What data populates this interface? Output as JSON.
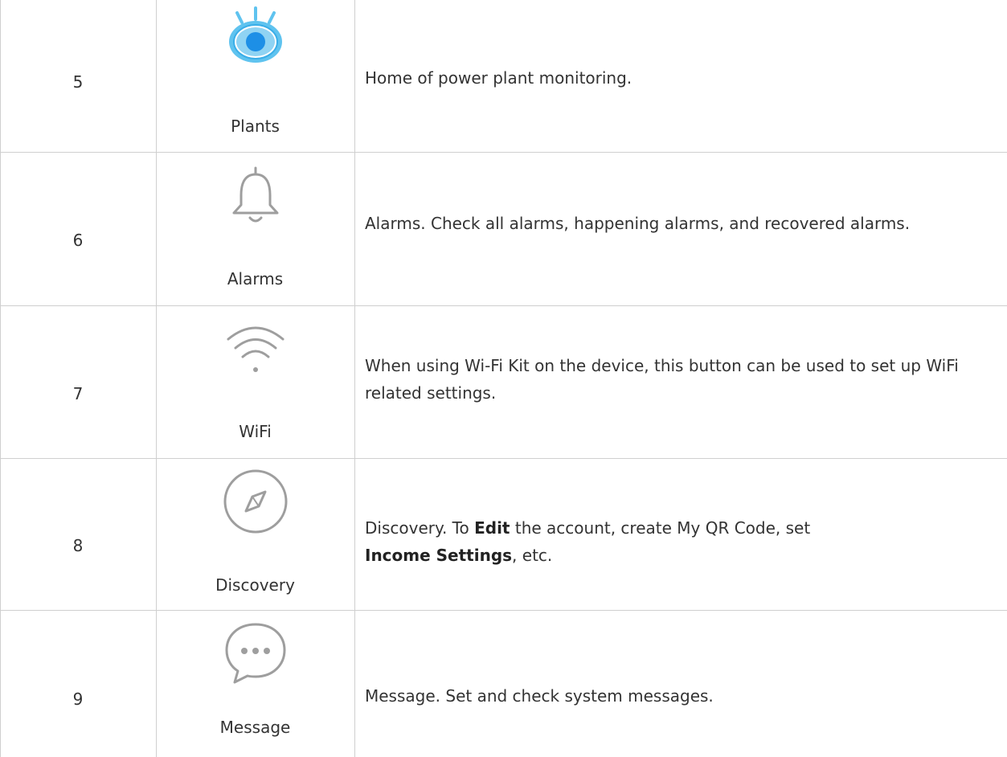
{
  "rows": [
    {
      "num": "5",
      "icon": "eye-icon",
      "label": "Plants",
      "desc": "Home of power plant monitoring."
    },
    {
      "num": "6",
      "icon": "bell-icon",
      "label": "Alarms",
      "desc": "Alarms. Check all alarms, happening alarms, and recovered alarms."
    },
    {
      "num": "7",
      "icon": "wifi-icon",
      "label": "WiFi",
      "desc": "When using Wi-Fi Kit on the device, this button can be used to set up WiFi related settings."
    },
    {
      "num": "8",
      "icon": "compass-icon",
      "label": "Discovery",
      "desc_parts": [
        "Discovery. To ",
        "Edit",
        " the account, create My QR Code, set ",
        "Income Settings",
        ", etc."
      ]
    },
    {
      "num": "9",
      "icon": "message-icon",
      "label": "Message",
      "desc": "Message. Set and check system messages."
    }
  ],
  "colors": {
    "plants_icon_fill": "#5fc3ef",
    "plants_icon_pupil": "#1d8fe6",
    "gray_icon": "#9e9e9e",
    "border": "#cfcfcf"
  }
}
